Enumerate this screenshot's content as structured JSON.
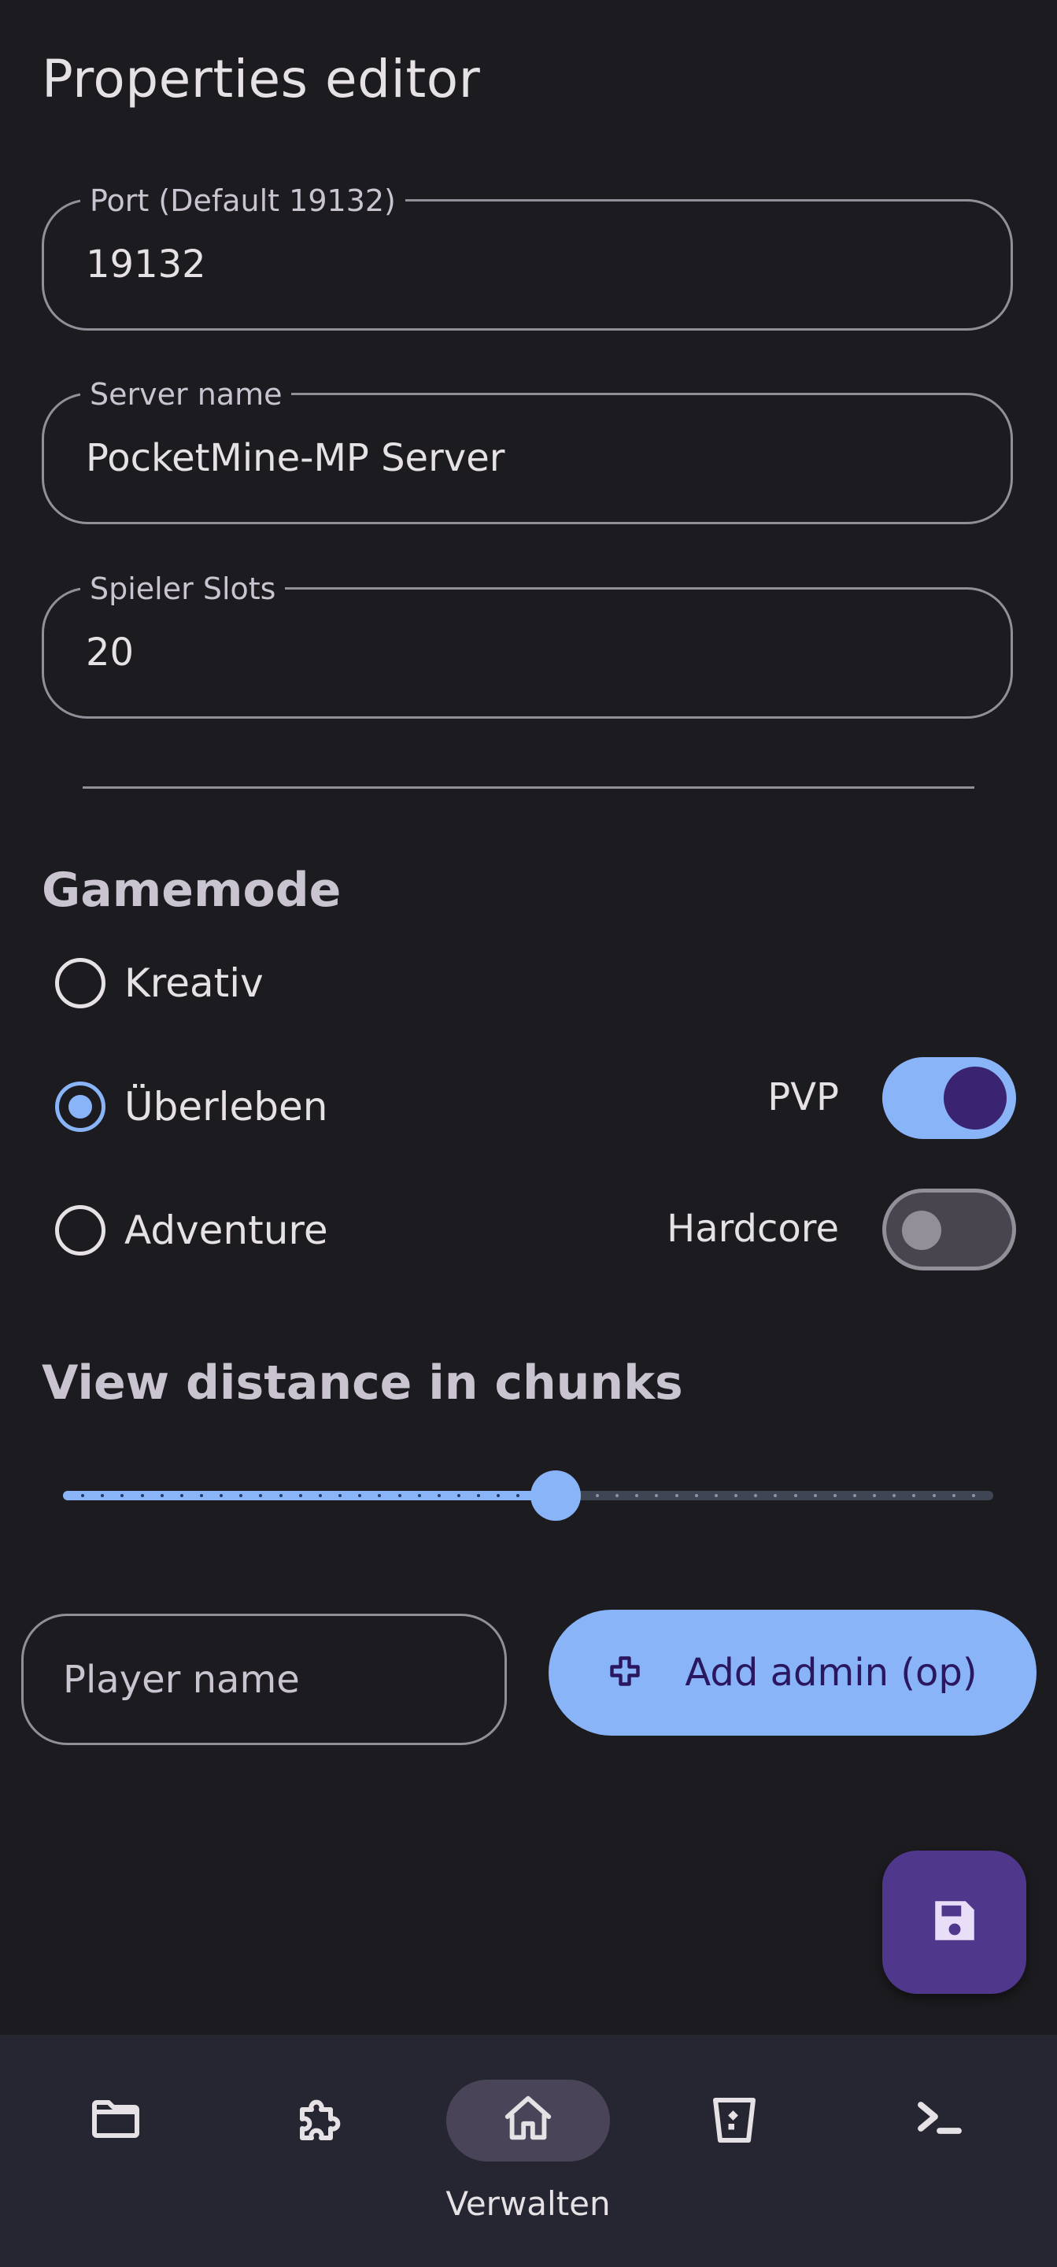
{
  "page": {
    "title": "Properties editor"
  },
  "fields": {
    "port": {
      "label": "Port (Default 19132)",
      "value": "19132"
    },
    "server_name": {
      "label": "Server name",
      "value": "PocketMine-MP Server"
    },
    "player_slots": {
      "label": "Spieler Slots",
      "value": "20"
    }
  },
  "gamemode": {
    "title": "Gamemode",
    "options": [
      {
        "label": "Kreativ",
        "selected": false
      },
      {
        "label": "Überleben",
        "selected": true
      },
      {
        "label": "Adventure",
        "selected": false
      }
    ]
  },
  "toggles": {
    "pvp": {
      "label": "PVP",
      "on": true
    },
    "hardcore": {
      "label": "Hardcore",
      "on": false
    }
  },
  "view_distance": {
    "title": "View distance in chunks",
    "value_fraction": 0.53
  },
  "admin": {
    "player_placeholder": "Player name",
    "add_button_label": "Add admin (op)"
  },
  "fab": {
    "icon": "save-icon"
  },
  "bottom_nav": {
    "items": [
      {
        "icon": "folder-icon",
        "label": ""
      },
      {
        "icon": "puzzle-icon",
        "label": ""
      },
      {
        "icon": "home-icon",
        "label": "Verwalten",
        "active": true
      },
      {
        "icon": "trash-icon",
        "label": ""
      },
      {
        "icon": "terminal-icon",
        "label": ""
      }
    ]
  },
  "colors": {
    "background": "#1c1b1f",
    "accent": "#8ab4f8",
    "fab": "#4f378b",
    "nav_background": "#252631"
  }
}
